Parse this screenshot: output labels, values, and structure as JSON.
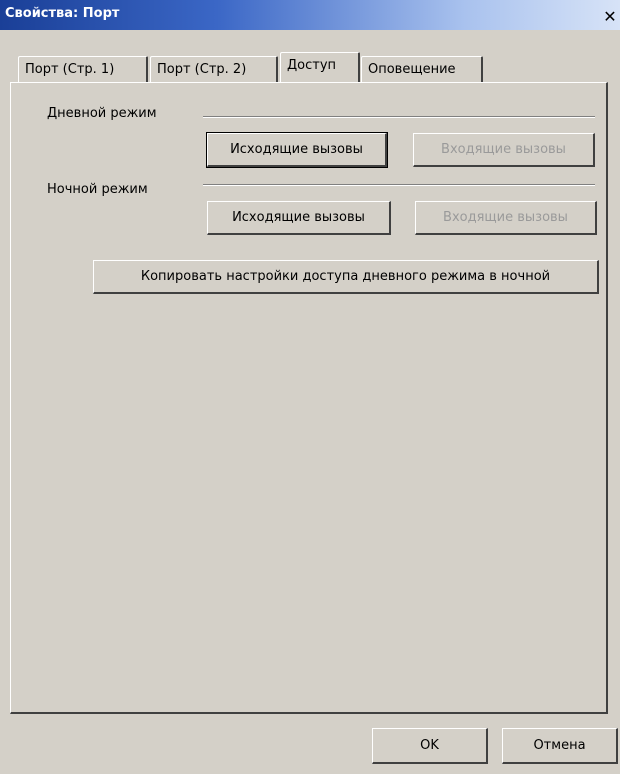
{
  "window": {
    "title": "Свойства: Порт",
    "close_glyph": "✕"
  },
  "tabs": [
    {
      "label": "Порт (Стр. 1)"
    },
    {
      "label": "Порт (Стр. 2)"
    },
    {
      "label": "Доступ"
    },
    {
      "label": "Оповещение"
    }
  ],
  "day_mode": {
    "label": "Дневной режим",
    "outgoing_button": "Исходящие вызовы",
    "incoming_button": "Входящие вызовы"
  },
  "night_mode": {
    "label": "Ночной режим",
    "outgoing_button": "Исходящие вызовы",
    "incoming_button": "Входящие вызовы"
  },
  "copy_button": "Копировать настройки доступа дневного режима в ночной",
  "footer": {
    "ok": "OK",
    "cancel": "Отмена"
  }
}
